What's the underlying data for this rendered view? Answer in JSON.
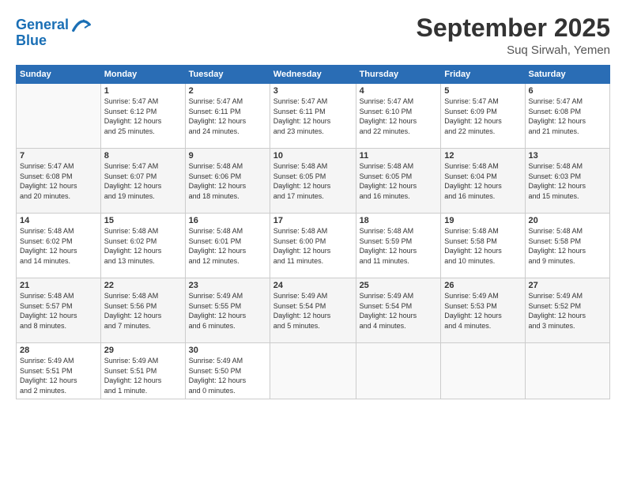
{
  "logo": {
    "text_general": "General",
    "text_blue": "Blue"
  },
  "header": {
    "month": "September 2025",
    "location": "Suq Sirwah, Yemen"
  },
  "weekdays": [
    "Sunday",
    "Monday",
    "Tuesday",
    "Wednesday",
    "Thursday",
    "Friday",
    "Saturday"
  ],
  "weeks": [
    [
      {
        "day": "",
        "info": ""
      },
      {
        "day": "1",
        "info": "Sunrise: 5:47 AM\nSunset: 6:12 PM\nDaylight: 12 hours\nand 25 minutes."
      },
      {
        "day": "2",
        "info": "Sunrise: 5:47 AM\nSunset: 6:11 PM\nDaylight: 12 hours\nand 24 minutes."
      },
      {
        "day": "3",
        "info": "Sunrise: 5:47 AM\nSunset: 6:11 PM\nDaylight: 12 hours\nand 23 minutes."
      },
      {
        "day": "4",
        "info": "Sunrise: 5:47 AM\nSunset: 6:10 PM\nDaylight: 12 hours\nand 22 minutes."
      },
      {
        "day": "5",
        "info": "Sunrise: 5:47 AM\nSunset: 6:09 PM\nDaylight: 12 hours\nand 22 minutes."
      },
      {
        "day": "6",
        "info": "Sunrise: 5:47 AM\nSunset: 6:08 PM\nDaylight: 12 hours\nand 21 minutes."
      }
    ],
    [
      {
        "day": "7",
        "info": "Sunrise: 5:47 AM\nSunset: 6:08 PM\nDaylight: 12 hours\nand 20 minutes."
      },
      {
        "day": "8",
        "info": "Sunrise: 5:47 AM\nSunset: 6:07 PM\nDaylight: 12 hours\nand 19 minutes."
      },
      {
        "day": "9",
        "info": "Sunrise: 5:48 AM\nSunset: 6:06 PM\nDaylight: 12 hours\nand 18 minutes."
      },
      {
        "day": "10",
        "info": "Sunrise: 5:48 AM\nSunset: 6:05 PM\nDaylight: 12 hours\nand 17 minutes."
      },
      {
        "day": "11",
        "info": "Sunrise: 5:48 AM\nSunset: 6:05 PM\nDaylight: 12 hours\nand 16 minutes."
      },
      {
        "day": "12",
        "info": "Sunrise: 5:48 AM\nSunset: 6:04 PM\nDaylight: 12 hours\nand 16 minutes."
      },
      {
        "day": "13",
        "info": "Sunrise: 5:48 AM\nSunset: 6:03 PM\nDaylight: 12 hours\nand 15 minutes."
      }
    ],
    [
      {
        "day": "14",
        "info": "Sunrise: 5:48 AM\nSunset: 6:02 PM\nDaylight: 12 hours\nand 14 minutes."
      },
      {
        "day": "15",
        "info": "Sunrise: 5:48 AM\nSunset: 6:02 PM\nDaylight: 12 hours\nand 13 minutes."
      },
      {
        "day": "16",
        "info": "Sunrise: 5:48 AM\nSunset: 6:01 PM\nDaylight: 12 hours\nand 12 minutes."
      },
      {
        "day": "17",
        "info": "Sunrise: 5:48 AM\nSunset: 6:00 PM\nDaylight: 12 hours\nand 11 minutes."
      },
      {
        "day": "18",
        "info": "Sunrise: 5:48 AM\nSunset: 5:59 PM\nDaylight: 12 hours\nand 11 minutes."
      },
      {
        "day": "19",
        "info": "Sunrise: 5:48 AM\nSunset: 5:58 PM\nDaylight: 12 hours\nand 10 minutes."
      },
      {
        "day": "20",
        "info": "Sunrise: 5:48 AM\nSunset: 5:58 PM\nDaylight: 12 hours\nand 9 minutes."
      }
    ],
    [
      {
        "day": "21",
        "info": "Sunrise: 5:48 AM\nSunset: 5:57 PM\nDaylight: 12 hours\nand 8 minutes."
      },
      {
        "day": "22",
        "info": "Sunrise: 5:48 AM\nSunset: 5:56 PM\nDaylight: 12 hours\nand 7 minutes."
      },
      {
        "day": "23",
        "info": "Sunrise: 5:49 AM\nSunset: 5:55 PM\nDaylight: 12 hours\nand 6 minutes."
      },
      {
        "day": "24",
        "info": "Sunrise: 5:49 AM\nSunset: 5:54 PM\nDaylight: 12 hours\nand 5 minutes."
      },
      {
        "day": "25",
        "info": "Sunrise: 5:49 AM\nSunset: 5:54 PM\nDaylight: 12 hours\nand 4 minutes."
      },
      {
        "day": "26",
        "info": "Sunrise: 5:49 AM\nSunset: 5:53 PM\nDaylight: 12 hours\nand 4 minutes."
      },
      {
        "day": "27",
        "info": "Sunrise: 5:49 AM\nSunset: 5:52 PM\nDaylight: 12 hours\nand 3 minutes."
      }
    ],
    [
      {
        "day": "28",
        "info": "Sunrise: 5:49 AM\nSunset: 5:51 PM\nDaylight: 12 hours\nand 2 minutes."
      },
      {
        "day": "29",
        "info": "Sunrise: 5:49 AM\nSunset: 5:51 PM\nDaylight: 12 hours\nand 1 minute."
      },
      {
        "day": "30",
        "info": "Sunrise: 5:49 AM\nSunset: 5:50 PM\nDaylight: 12 hours\nand 0 minutes."
      },
      {
        "day": "",
        "info": ""
      },
      {
        "day": "",
        "info": ""
      },
      {
        "day": "",
        "info": ""
      },
      {
        "day": "",
        "info": ""
      }
    ]
  ]
}
